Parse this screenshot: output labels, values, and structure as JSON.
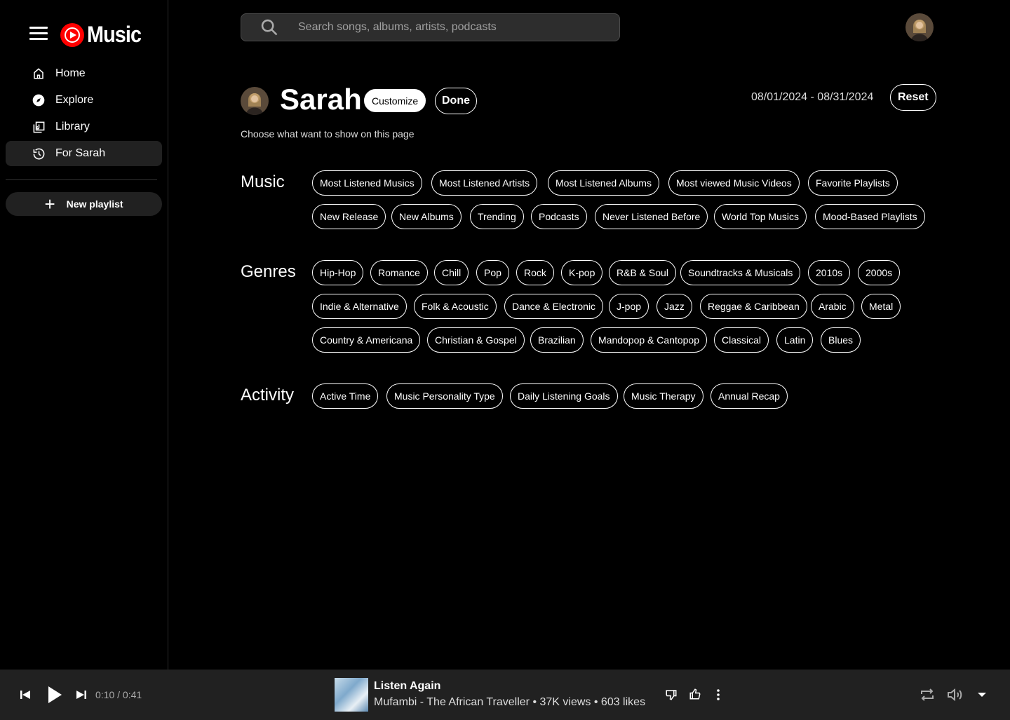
{
  "app": {
    "logo_text": "Music",
    "brand_color": "#ff0000"
  },
  "sidebar": {
    "items": [
      {
        "label": "Home",
        "icon": "home-icon"
      },
      {
        "label": "Explore",
        "icon": "compass-icon"
      },
      {
        "label": "Library",
        "icon": "library-icon"
      },
      {
        "label": "For Sarah",
        "icon": "history-icon"
      }
    ],
    "new_playlist": "New playlist"
  },
  "search": {
    "placeholder": "Search songs, albums, artists, podcasts"
  },
  "profile": {
    "name": "Sarah",
    "customize_label": "Customize",
    "done_label": "Done",
    "date_range": "08/01/2024 - 08/31/2024",
    "reset_label": "Reset",
    "subtitle": "Choose what want to show on this page"
  },
  "sections": {
    "music": {
      "title": "Music",
      "chips": [
        "Most Listened Musics",
        "Most Listened Artists",
        "Most Listened Albums",
        "Most viewed Music Videos",
        "Favorite Playlists",
        "New Release",
        "New Albums",
        "Trending",
        "Podcasts",
        "Never Listened Before",
        "World Top Musics",
        "Mood-Based Playlists"
      ]
    },
    "genres": {
      "title": "Genres",
      "chips": [
        "Hip-Hop",
        "Romance",
        "Chill",
        "Pop",
        "Rock",
        "K-pop",
        "R&B & Soul",
        "Soundtracks & Musicals",
        "2010s",
        "2000s",
        "Indie & Alternative",
        "Folk & Acoustic",
        "Dance & Electronic",
        "J-pop",
        "Jazz",
        "Reggae & Caribbean",
        "Arabic",
        "Metal",
        "Country & Americana",
        "Christian & Gospel",
        "Brazilian",
        "Mandopop & Cantopop",
        "Classical",
        "Latin",
        "Blues"
      ]
    },
    "activity": {
      "title": "Activity",
      "chips": [
        "Active Time",
        "Music Personality Type",
        "Daily Listening Goals",
        "Music Therapy",
        "Annual Recap"
      ]
    }
  },
  "player": {
    "time": "0:10 / 0:41",
    "title": "Listen Again",
    "meta": "Mufambi - The African Traveller • 37K views • 603 likes"
  }
}
